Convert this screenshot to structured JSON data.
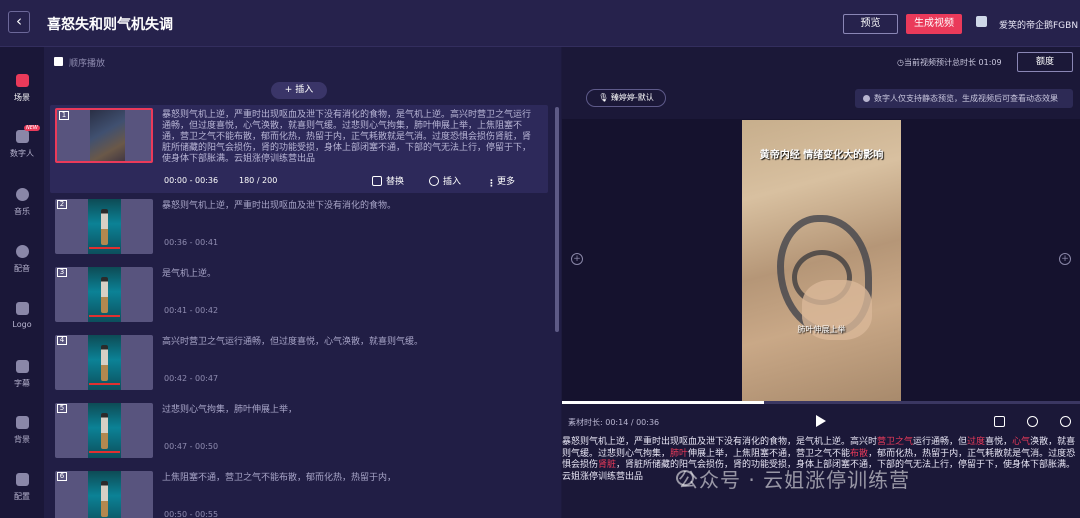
{
  "header": {
    "back_icon": "chevron-left-icon",
    "title": "喜怒失和则气机失调",
    "preview_label": "预览",
    "generate_label": "生成视频",
    "username": "爱笑的帝企鹅FGBN",
    "accent_color": "#ea3a5a"
  },
  "sidebar": {
    "items": [
      {
        "label": "场景",
        "icon": "scene-icon",
        "active": true
      },
      {
        "label": "数字人",
        "icon": "digital-human-icon",
        "badge": "NEW"
      },
      {
        "label": "音乐",
        "icon": "music-icon"
      },
      {
        "label": "配音",
        "icon": "dubbing-icon"
      },
      {
        "label": "Logo",
        "icon": "logo-icon"
      },
      {
        "label": "字幕",
        "icon": "subtitle-icon"
      },
      {
        "label": "背景",
        "icon": "background-icon"
      },
      {
        "label": "配置",
        "icon": "config-icon"
      }
    ]
  },
  "list": {
    "order_play_label": "顺序播放",
    "insert_label": "+ 插入",
    "actions": {
      "replace": "替换",
      "insert": "插入",
      "more": "更多"
    },
    "scenes": [
      {
        "num": "1",
        "text": "暴怒则气机上逆，严重时出现呕血及泄下没有消化的食物，是气机上逆。高兴时营卫之气运行通畅，但过度喜悦，心气涣散，就喜则气缓。过悲则心气拘集，肺叶伸展上举，上焦阻塞不通，营卫之气不能布散，郁而化热，热留于内，正气耗散就是气消。过度恐惧会损伤肾脏，肾脏所储藏的阳气会损伤，肾的功能受损，身体上部闭塞不通，下部的气无法上行，停留于下，使身体下部胀满。云姐涨停训练营出品",
        "time": "00:00 - 00:36",
        "count": "180 / 200"
      },
      {
        "num": "2",
        "text": "暴怒则气机上逆，严重时出现呕血及泄下没有消化的食物。",
        "time": "00:36 - 00:41"
      },
      {
        "num": "3",
        "text": "是气机上逆。",
        "time": "00:41 - 00:42"
      },
      {
        "num": "4",
        "text": "高兴时营卫之气运行通畅，但过度喜悦，心气涣散，就喜则气缓。",
        "time": "00:42 - 00:47"
      },
      {
        "num": "5",
        "text": "过悲则心气拘集，肺叶伸展上举，",
        "time": "00:47 - 00:50"
      },
      {
        "num": "6",
        "text": "上焦阻塞不通，营卫之气不能布散，郁而化热，热留于内，",
        "time": "00:50 - 00:55"
      }
    ]
  },
  "preview": {
    "total_time": "◷当前视频预计总时长 01:09",
    "quota_label": "额度",
    "voice_label": "臻婷婷-默认",
    "notice": "数字人仅支持静态预览，生成视频后可查看动态效果",
    "video_caption": "黄帝内经  情绪变化大的影响",
    "video_subtitle": "肺叶伸展上举",
    "clip_duration": "素材时长: 00:14 / 00:36",
    "progress": 0.39,
    "subtitle_parts": [
      {
        "t": "暴怒则气机上逆，严重时出现呕血及泄下没有消化的食物，是气机上逆。高兴时",
        "hl": false
      },
      {
        "t": "营卫之气",
        "hl": true
      },
      {
        "t": "运行通畅，但",
        "hl": false
      },
      {
        "t": "过度",
        "hl": true
      },
      {
        "t": "喜悦，",
        "hl": false
      },
      {
        "t": "心气",
        "hl": true
      },
      {
        "t": "涣散，就喜则气缓。过悲则心气拘集，",
        "hl": false
      },
      {
        "t": "肺叶",
        "hl": true
      },
      {
        "t": "伸展上举，上焦阻塞不通，营卫之气不能",
        "hl": false
      },
      {
        "t": "布散",
        "hl": true
      },
      {
        "t": "，郁而化热，热留于内，正气耗散就是气消。过度恐惧会损伤",
        "hl": false
      },
      {
        "t": "肾脏",
        "hl": true
      },
      {
        "t": "，肾脏所储藏的阳气会损伤，肾的功能受损，身体上部闭塞不通，下部的气无法上行，停留于下，使身体下部胀满。云姐涨停训练营出品",
        "hl": false
      }
    ]
  },
  "watermark": "公众号 · 云姐涨停训练营"
}
